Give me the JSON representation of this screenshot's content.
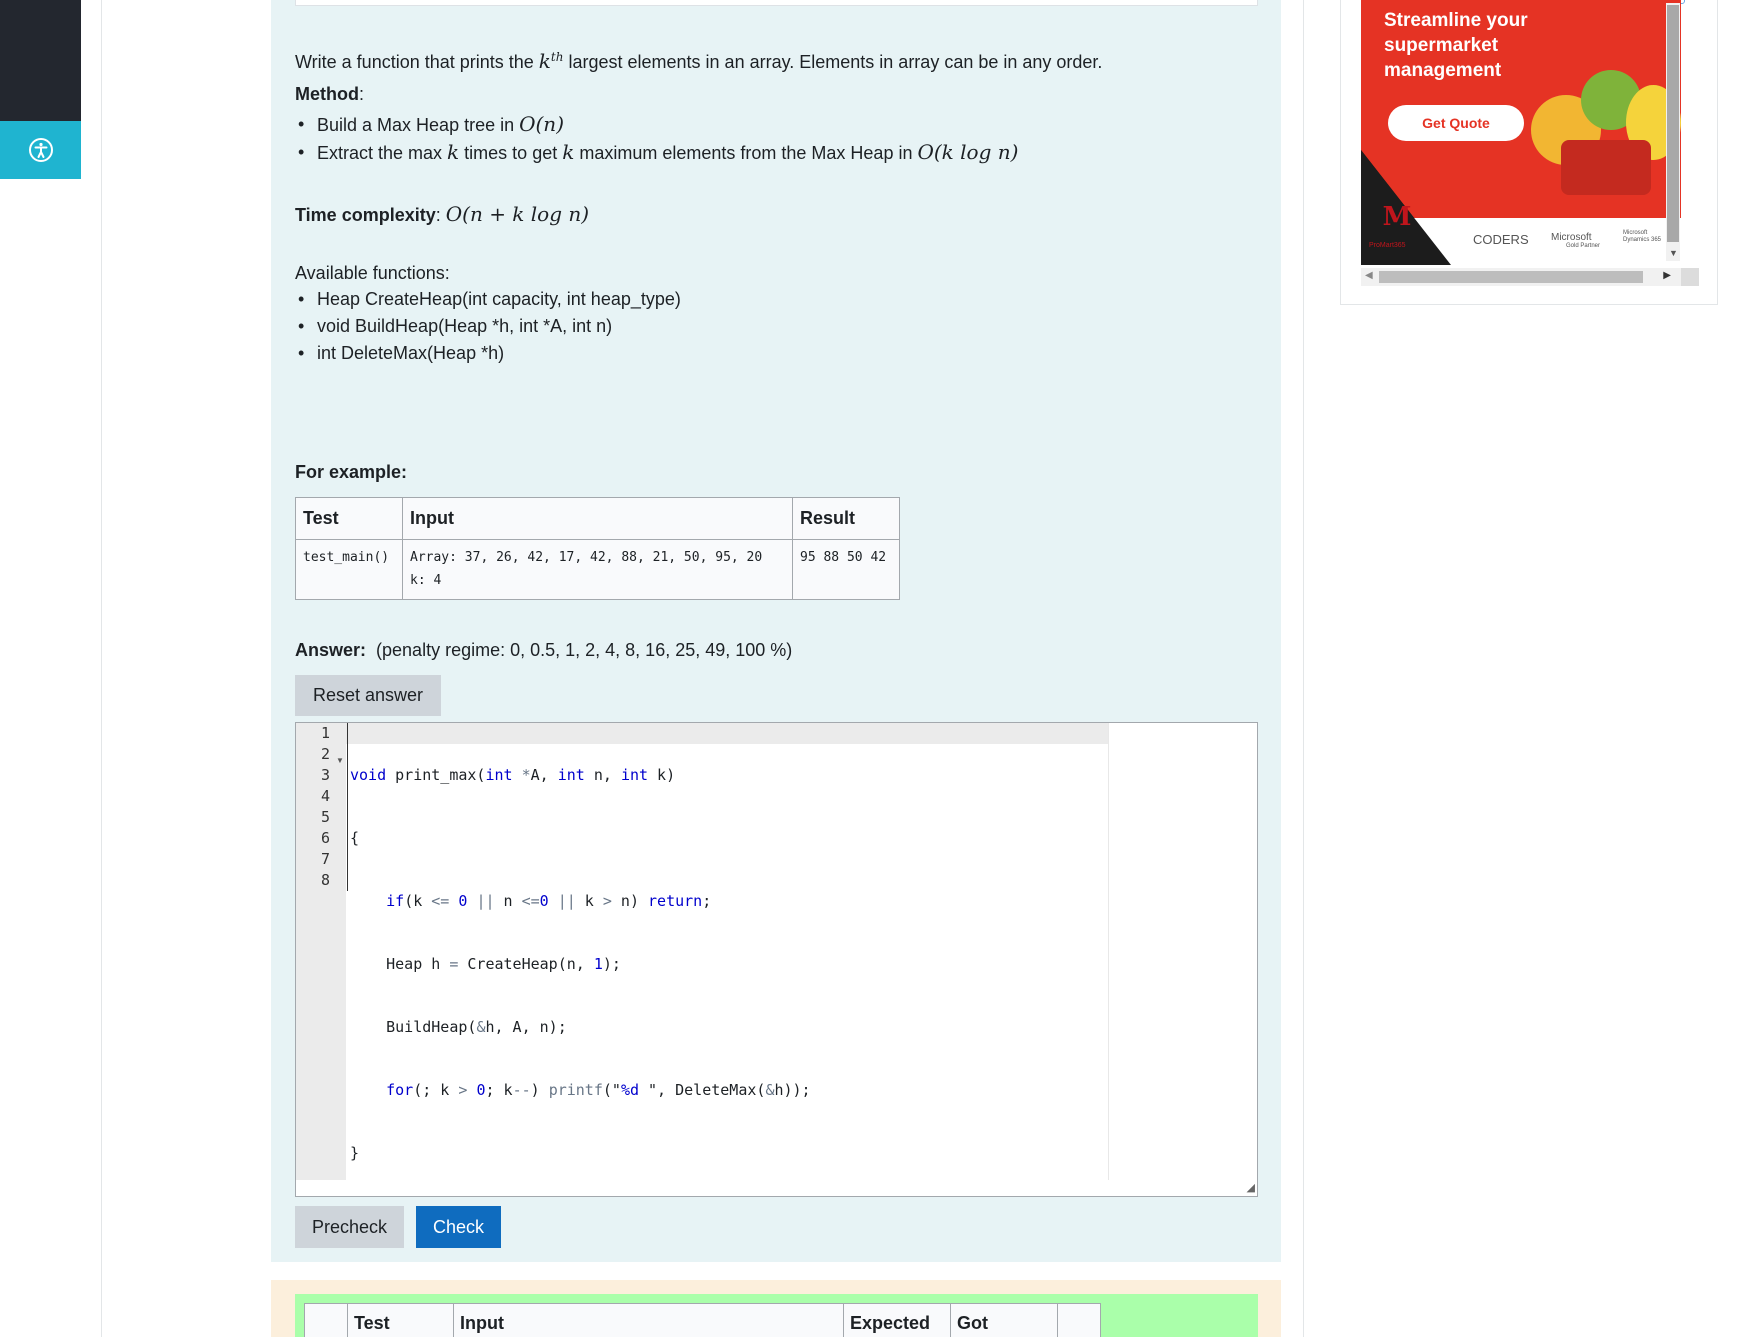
{
  "question": {
    "intro_before": "Write a function that prints the ",
    "intro_k": "k",
    "intro_th": "th",
    "intro_after": " largest elements in an array. Elements in array can be in any order.",
    "method_label": "Method",
    "method_colon": ":",
    "method_items": [
      {
        "text": "Build a Max Heap tree in ",
        "math": "O(n)"
      },
      {
        "text_a": "Extract the max ",
        "k1": "k",
        "text_b": " times to get ",
        "k2": "k",
        "text_c": " maximum elements from the Max Heap in ",
        "math": "O(k log n)"
      }
    ],
    "time_label": "Time complexity",
    "time_colon": ": ",
    "time_math": "O(n + k log n)",
    "functions_label": "Available functions:",
    "functions": [
      "Heap CreateHeap(int capacity, int heap_type)",
      "void BuildHeap(Heap *h, int *A, int n)",
      "int DeleteMax(Heap *h)"
    ],
    "example_title": "For example:",
    "example_headers": [
      "Test",
      "Input",
      "Result"
    ],
    "example_row": {
      "test": "test_main()",
      "input": "Array: 37, 26, 42, 17, 42, 88, 21, 50, 95, 20\nk: 4",
      "result": "95 88 50 42"
    },
    "answer_label": "Answer:",
    "penalty": "(penalty regime: 0, 0.5, 1, 2, 4, 8, 16, 25, 49, 100 %)",
    "reset_button": "Reset answer",
    "precheck_button": "Precheck",
    "check_button": "Check"
  },
  "editor": {
    "line_numbers": [
      "1",
      "2",
      "3",
      "4",
      "5",
      "6",
      "7",
      "8"
    ],
    "code_lines": [
      "void print_max(int *A, int n, int k)",
      "{",
      "    if(k <= 0 || n <=0 || k > n) return;",
      "    Heap h = CreateHeap(n, 1);",
      "    BuildHeap(&h, A, n);",
      "    for(; k > 0; k--) printf(\"%d \", DeleteMax(&h));",
      "}",
      ""
    ]
  },
  "result_table": {
    "headers": [
      "",
      "Test",
      "Input",
      "Expected",
      "Got",
      ""
    ]
  },
  "ad": {
    "title": "Streamline your supermarket management",
    "cta": "Get Quote",
    "logo_sub": "ProMart365",
    "partners": [
      "CODERS",
      "Microsoft",
      "Gold Partner",
      "Microsoft Dynamics 365"
    ],
    "brand_red": "#e53324"
  },
  "colors": {
    "question_bg": "#e7f3f5",
    "primary_button": "#0f6cbf",
    "secondary_button": "#ced4da",
    "accessibility_button": "#1fb4d0",
    "result_bg": "#fcefdc",
    "result_pass": "#aaffaa"
  },
  "icons": {
    "accessibility": "accessibility-icon",
    "fold": "fold-arrow-icon",
    "resize": "resize-handle-icon"
  }
}
